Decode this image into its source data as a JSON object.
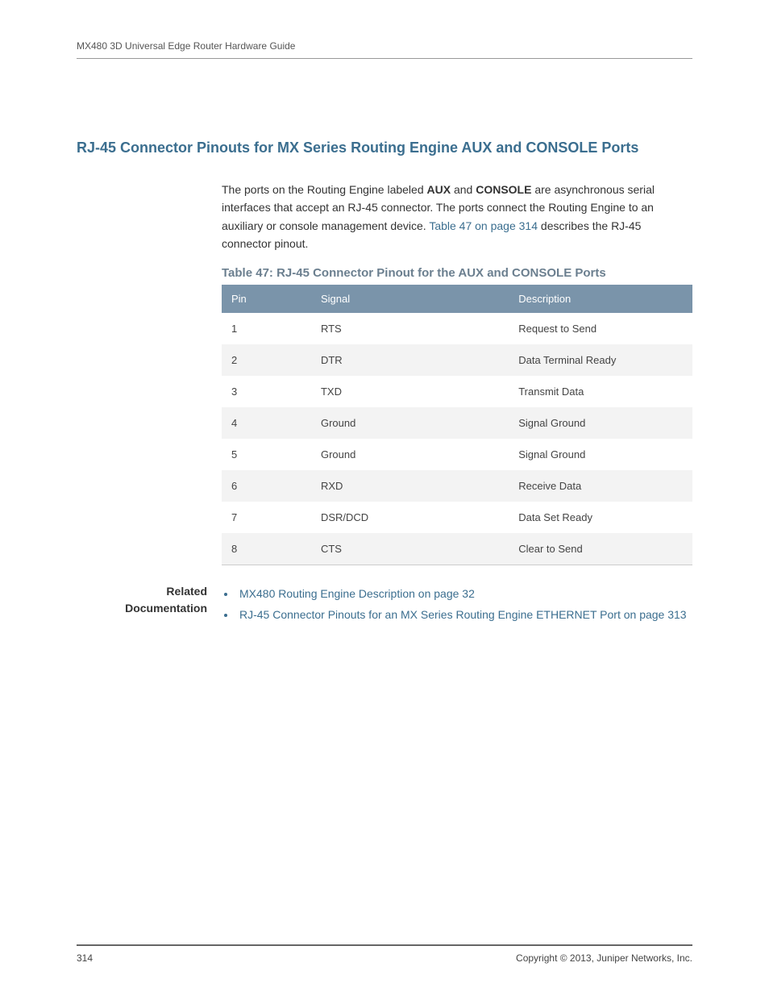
{
  "running_header": "MX480 3D Universal Edge Router Hardware Guide",
  "section_title": "RJ-45 Connector Pinouts for MX Series Routing Engine AUX and CONSOLE Ports",
  "intro": {
    "pre1": "The ports on the Routing Engine labeled ",
    "bold1": "AUX",
    "mid1": " and ",
    "bold2": "CONSOLE",
    "post1": " are asynchronous serial interfaces that accept an RJ-45 connector. The ports connect the Routing Engine to an auxiliary or console management device. ",
    "link_text": "Table 47 on page 314",
    "post2": " describes the RJ-45 connector pinout."
  },
  "table_caption": "Table 47: RJ-45 Connector Pinout for the AUX and CONSOLE Ports",
  "table": {
    "headers": {
      "pin": "Pin",
      "signal": "Signal",
      "description": "Description"
    },
    "rows": [
      {
        "pin": "1",
        "signal": "RTS",
        "description": "Request to Send"
      },
      {
        "pin": "2",
        "signal": "DTR",
        "description": "Data Terminal Ready"
      },
      {
        "pin": "3",
        "signal": "TXD",
        "description": "Transmit Data"
      },
      {
        "pin": "4",
        "signal": "Ground",
        "description": "Signal Ground"
      },
      {
        "pin": "5",
        "signal": "Ground",
        "description": "Signal Ground"
      },
      {
        "pin": "6",
        "signal": "RXD",
        "description": "Receive Data"
      },
      {
        "pin": "7",
        "signal": "DSR/DCD",
        "description": "Data Set Ready"
      },
      {
        "pin": "8",
        "signal": "CTS",
        "description": "Clear to Send"
      }
    ]
  },
  "related": {
    "label_line1": "Related",
    "label_line2": "Documentation",
    "items": [
      "MX480 Routing Engine Description on page 32",
      "RJ-45 Connector Pinouts for an MX Series Routing Engine ETHERNET Port on page 313"
    ]
  },
  "footer": {
    "page_number": "314",
    "copyright": "Copyright © 2013, Juniper Networks, Inc."
  }
}
